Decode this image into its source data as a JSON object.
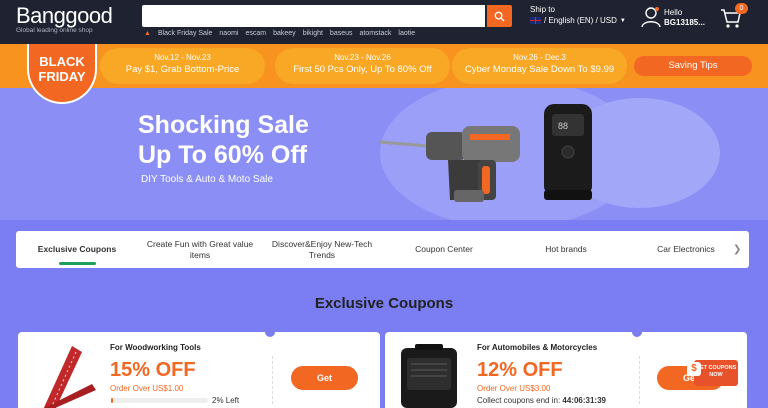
{
  "header": {
    "logo": "Banggood",
    "tagline": "Global leading online shop",
    "hot_words": [
      "Black Friday Sale",
      "naomi",
      "escam",
      "bakeey",
      "bikight",
      "baseus",
      "atomstack",
      "laotie"
    ],
    "ship_label": "Ship to",
    "locale": "/ English (EN) / USD",
    "hello": "Hello",
    "user_id": "BG13185...",
    "cart_count": "0"
  },
  "promo": {
    "badge_line1": "BLACK",
    "badge_line2": "FRIDAY",
    "items": [
      {
        "date": "Nov.12 - Nov.23",
        "text": "Pay $1, Grab Bottom-Price"
      },
      {
        "date": "Nov.23 - Nov.26",
        "text": "First 50 Pcs Only, Up To 80% Off"
      },
      {
        "date": "Nov.26 - Dec.3",
        "text": "Cyber Monday Sale Down To $9.99"
      }
    ],
    "tips_label": "Saving Tips"
  },
  "banner": {
    "line1": "Shocking Sale",
    "line2": "Up To 60% Off",
    "sub": "DIY Tools & Auto & Moto Sale"
  },
  "tabs": [
    {
      "label": "Exclusive Coupons"
    },
    {
      "label": "Create Fun with Great value items"
    },
    {
      "label": "Discover&Enjoy New-Tech Trends"
    },
    {
      "label": "Coupon Center"
    },
    {
      "label": "Hot brands"
    },
    {
      "label": "Car Electronics"
    }
  ],
  "section_title": "Exclusive Coupons",
  "coupons": [
    {
      "category": "For Woodworking Tools",
      "discount": "15% OFF",
      "min": "Order Over US$1.00",
      "left": "2% Left",
      "button": "Get",
      "progress_pct": 2
    },
    {
      "category": "For Automobiles & Motorcycles",
      "discount": "12% OFF",
      "min": "Order Over US$3.00",
      "countdown_label": "Collect coupons end in:",
      "countdown": "44:06:31:39",
      "button": "Get"
    }
  ],
  "float_badge": "GET COUPONS NOW",
  "colors": {
    "accent": "#f26722",
    "header_bg": "#1f2230",
    "promo_bg": "#f7931e",
    "page_bg": "#7b7ef3"
  }
}
